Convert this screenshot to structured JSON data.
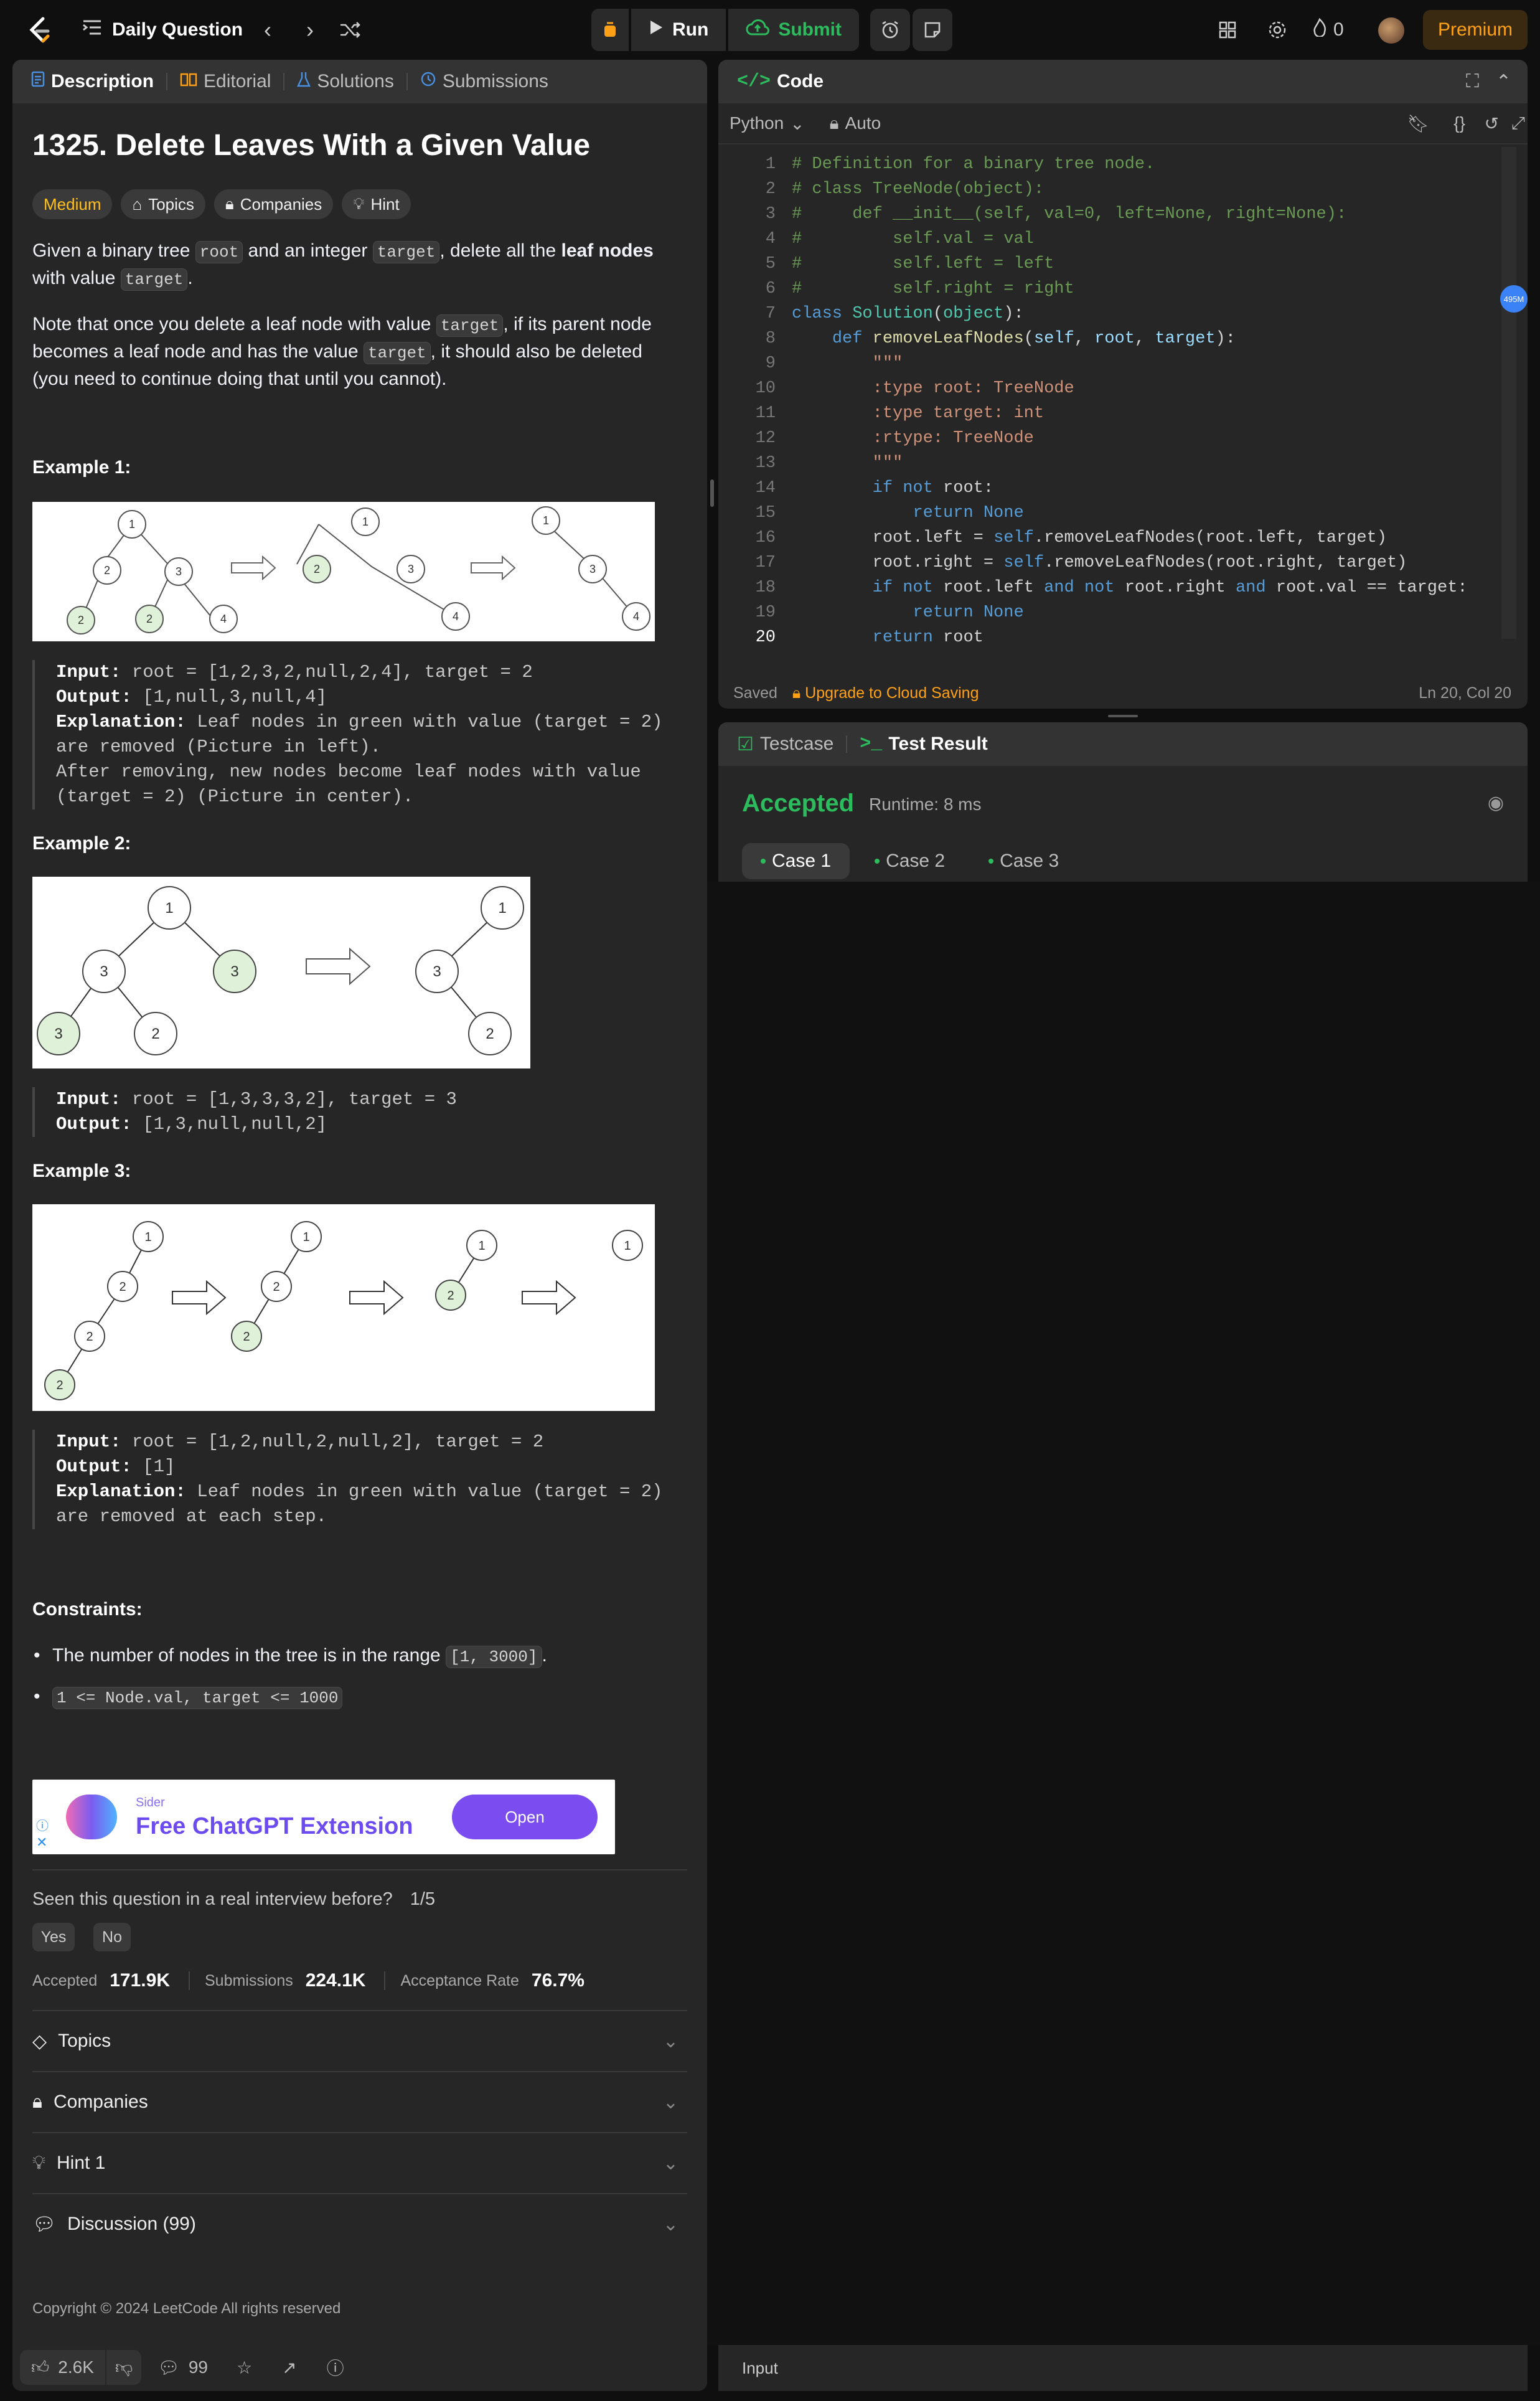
{
  "header": {
    "title": "Daily Question",
    "run_label": "Run",
    "submit_label": "Submit",
    "streak": "0",
    "premium_label": "Premium"
  },
  "left_tabs": [
    "Description",
    "Editorial",
    "Solutions",
    "Submissions"
  ],
  "problem": {
    "title": "1325. Delete Leaves With a Given Value",
    "difficulty": "Medium",
    "tags": [
      "Topics",
      "Companies",
      "Hint"
    ],
    "p1": {
      "a": "Given a binary tree ",
      "c1": "root",
      "b": " and an integer ",
      "c2": "target",
      "d": ", delete all the ",
      "bold": "leaf nodes",
      "e": " with value ",
      "c3": "target",
      "f": "."
    },
    "p2": {
      "a": "Note that once you delete a leaf node with value ",
      "c1": "target",
      "b": ", if its parent node becomes a leaf node and has the value ",
      "c2": "target",
      "c": ", it should also be deleted (you need to continue doing that until you cannot)."
    }
  },
  "examples": [
    {
      "heading": "Example 1:",
      "input_label": "Input:",
      "input": "root = [1,2,3,2,null,2,4], target = 2",
      "output_label": "Output:",
      "output": "[1,null,3,null,4]",
      "expl_label": "Explanation:",
      "explanation": "Leaf nodes in green with value (target = 2) are removed (Picture in left).",
      "explanation2": "After removing, new nodes become leaf nodes with value (target = 2) (Picture in center)."
    },
    {
      "heading": "Example 2:",
      "input_label": "Input:",
      "input": "root = [1,3,3,3,2], target = 3",
      "output_label": "Output:",
      "output": "[1,3,null,null,2]"
    },
    {
      "heading": "Example 3:",
      "input_label": "Input:",
      "input": "root = [1,2,null,2,null,2], target = 2",
      "output_label": "Output:",
      "output": "[1]",
      "expl_label": "Explanation:",
      "explanation": "Leaf nodes in green with value (target = 2) are removed at each step."
    }
  ],
  "constraints": {
    "heading": "Constraints:",
    "c1_text": "The number of nodes in the tree is in the range ",
    "c1_code": "[1, 3000]",
    "c1_end": ".",
    "c2_code": "1 <= Node.val, target <= 1000"
  },
  "ad": {
    "brand": "Sider",
    "title": "Free ChatGPT Extension",
    "button": "Open"
  },
  "survey": {
    "question": "Seen this question in a real interview before?",
    "count": "1/5",
    "yes": "Yes",
    "no": "No"
  },
  "stats": {
    "accepted_label": "Accepted",
    "accepted": "171.9K",
    "submissions_label": "Submissions",
    "submissions": "224.1K",
    "rate_label": "Acceptance Rate",
    "rate": "76.7%"
  },
  "accordions": [
    "Topics",
    "Companies",
    "Hint 1",
    "Discussion (99)"
  ],
  "footer": {
    "copyright": "Copyright © 2024 LeetCode All rights reserved",
    "likes": "2.6K",
    "comments": "99"
  },
  "code": {
    "tab_label": "Code",
    "language": "Python",
    "mode": "Auto",
    "saved": "Saved",
    "upgrade": "Upgrade to Cloud Saving",
    "cursor": "Ln 20, Col 20",
    "memory_badge": "495M",
    "line_numbers": [
      "1",
      "2",
      "3",
      "4",
      "5",
      "6",
      "7",
      "8",
      "9",
      "10",
      "11",
      "12",
      "13",
      "14",
      "15",
      "16",
      "17",
      "18",
      "19",
      "20"
    ]
  },
  "result": {
    "testcase_tab": "Testcase",
    "result_tab": "Test Result",
    "status": "Accepted",
    "runtime": "Runtime: 8 ms",
    "cases": [
      "Case 1",
      "Case 2",
      "Case 3"
    ],
    "input_label": "Input"
  },
  "colors": {
    "accent_orange": "#ffa116",
    "success_green": "#2cbb5d",
    "panel_bg": "#262626",
    "tab_bg": "#333333"
  }
}
